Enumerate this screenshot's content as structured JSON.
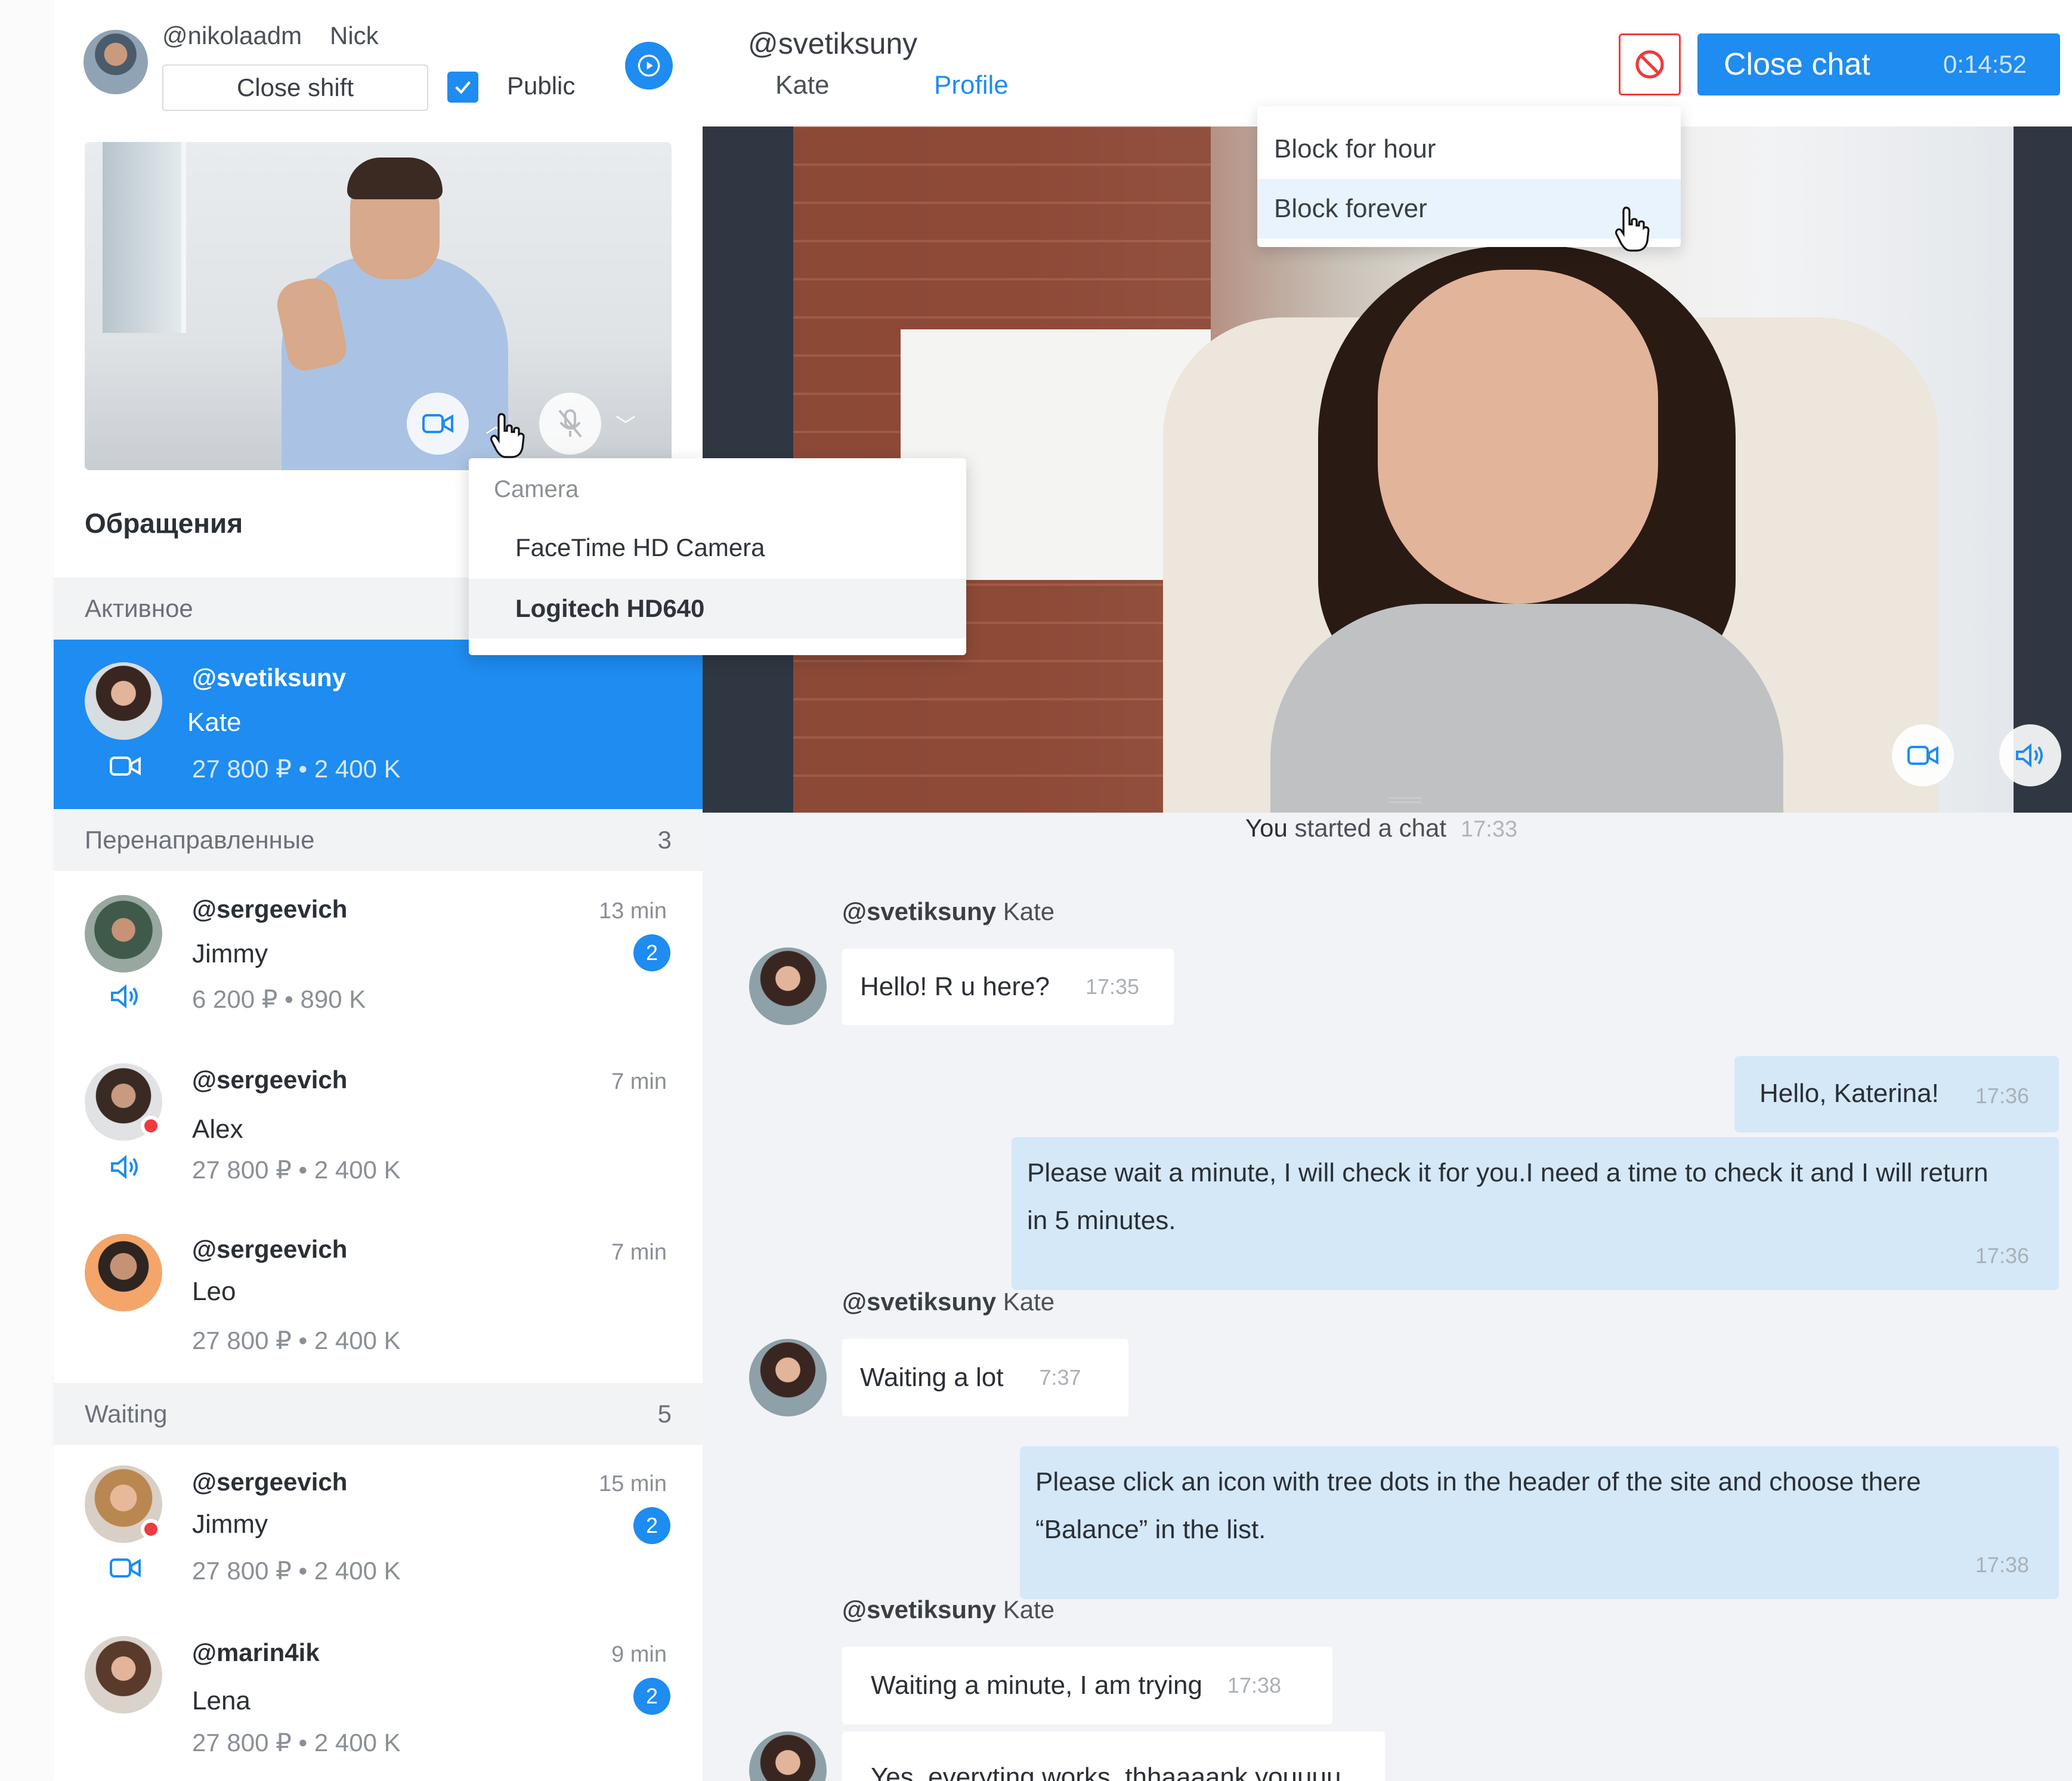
{
  "operator": {
    "handle": "@nikolaadm",
    "name": "Nick",
    "close_shift_label": "Close shift",
    "public_label": "Public",
    "public_checked": true
  },
  "camera_menu": {
    "title": "Camera",
    "options": [
      "FaceTime HD Camera",
      "Logitech HD640"
    ],
    "selected": "Logitech HD640"
  },
  "sidebar": {
    "title": "Обращения",
    "active_group": {
      "label": "Активное"
    },
    "active_chat": {
      "handle": "@svetiksuny",
      "name": "Kate",
      "stats": "27 800 ₽  •  2 400 K",
      "icon": "video-camera-icon"
    },
    "redirected_group": {
      "label": "Перенаправленные",
      "count": "3"
    },
    "redirected": [
      {
        "handle": "@sergeevich",
        "name": "Jimmy",
        "stats": "6 200 ₽  •  890 K",
        "time": "13 min",
        "badge": "2",
        "icon": "speaker-icon"
      },
      {
        "handle": "@sergeevich",
        "name": "Alex",
        "stats": "27 800 ₽  •  2 400 K",
        "time": "7 min",
        "icon": "speaker-icon"
      },
      {
        "handle": "@sergeevich",
        "name": "Leo",
        "stats": "27 800 ₽  •  2 400 K",
        "time": "7 min"
      }
    ],
    "waiting_group": {
      "label": "Waiting",
      "count": "5"
    },
    "waiting": [
      {
        "handle": "@sergeevich",
        "name": "Jimmy",
        "stats": "27 800 ₽  •  2 400 K",
        "time": "15 min",
        "badge": "2",
        "icon": "video-camera-icon"
      },
      {
        "handle": "@marin4ik",
        "name": "Lena",
        "stats": "27 800 ₽  •  2 400 K",
        "time": "9 min",
        "badge": "2"
      }
    ]
  },
  "chat_header": {
    "handle": "@svetiksuny",
    "tab_name": "Kate",
    "tab_profile": "Profile",
    "close_chat_label": "Close chat",
    "timer": "0:14:52"
  },
  "block_menu": {
    "items": [
      "Block for hour",
      "Block forever"
    ],
    "hovered": "Block forever"
  },
  "messages": {
    "system": {
      "text_bold": "You",
      "text": " started a chat",
      "time": "17:33"
    },
    "list": [
      {
        "sender_handle": "@svetiksuny",
        "sender_name": "Kate",
        "text": "Hello! R u here?",
        "time": "17:35"
      },
      {
        "text": "Hello, Katerina!",
        "time": "17:36"
      },
      {
        "text": "Please wait a minute, I will check it for you.I need a time to check it and I will return in  5 minutes.",
        "time": "17:36"
      },
      {
        "sender_handle": "@svetiksuny",
        "sender_name": "Kate",
        "text": "Waiting a lot",
        "time": "7:37"
      },
      {
        "text": "Please click an icon with tree dots in the header of the site and choose there “Balance” in the list.",
        "time": "17:38"
      },
      {
        "sender_handle": "@svetiksuny",
        "sender_name": "Kate",
        "text": "Waiting a minute, I am trying",
        "time": "17:38"
      },
      {
        "text": "Yes, everyting works, thhaaaank youuuu"
      }
    ]
  },
  "colors": {
    "accent": "#1e8cf0",
    "danger": "#ef3b3b",
    "outgoing_bubble": "#d4e8f7"
  }
}
